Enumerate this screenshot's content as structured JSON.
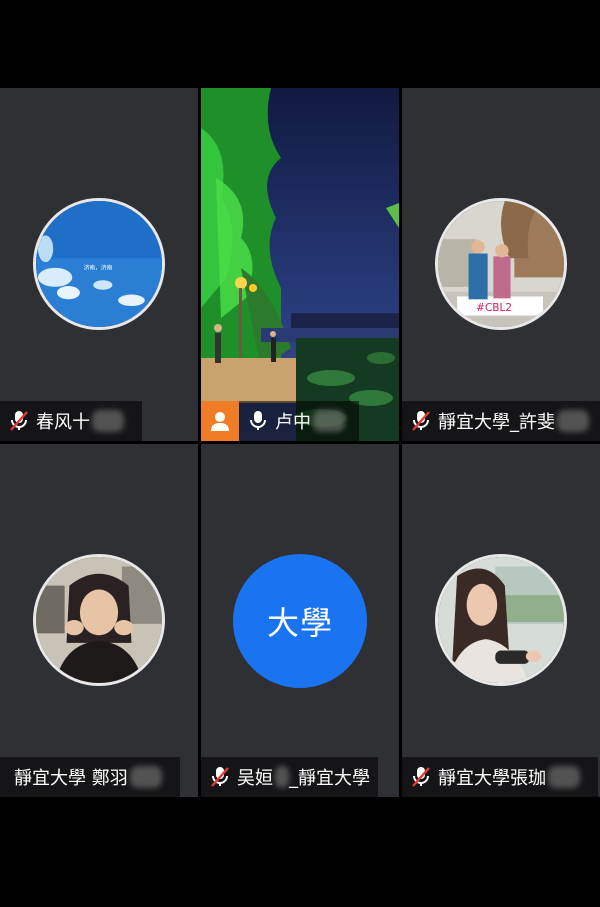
{
  "colors": {
    "tile_bg": "#2f3033",
    "active_border": "#4caf50",
    "initials_bg": "#1a74f2",
    "muted_red": "#e53935",
    "chip_orange": "#f07c26"
  },
  "participants": [
    {
      "name": "春风十",
      "mic": "muted",
      "avatar": "sky-photo"
    },
    {
      "name": "卢中",
      "mic": "on",
      "avatar": "night-park-video",
      "active": true,
      "user_chip_icon": "person-icon"
    },
    {
      "name": "靜宜大學_許斐",
      "mic": "muted",
      "avatar": "couple-photo"
    },
    {
      "name": "靜宜大學 鄭羽",
      "mic": "none",
      "avatar": "woman-photo"
    },
    {
      "name": "吴姮",
      "name_suffix": "_靜宜大學",
      "mic": "muted",
      "avatar": "initials",
      "initials": "大學"
    },
    {
      "name": "靜宜大學張珈",
      "mic": "muted",
      "avatar": "girl-photo"
    }
  ]
}
